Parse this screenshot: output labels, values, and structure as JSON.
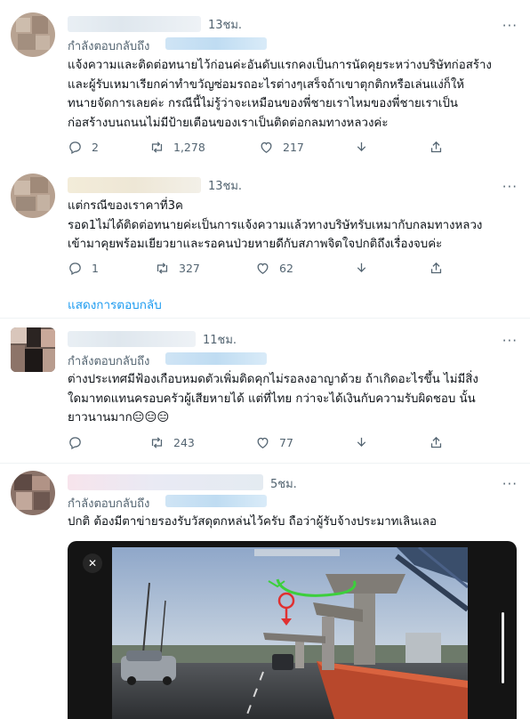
{
  "tweets": [
    {
      "time": "13ชม.",
      "reply_label": "กำลังตอบกลับถึง",
      "text": "แจ้งความและติดต่อทนายไว้ก่อนค่ะอันดับแรกคงเป็นการนัดคุยระหว่างบริษัทก่อสร้าง\nและผู้รับเหมาเรียกค่าทำขวัญซ่อมรถอะไรต่างๆเสร็จถ้าเขาตุกติกหรือเล่นแง่ก็ให้\nทนายจัดการเลยค่ะ กรณีนี้ไม่รู้ว่าจะเหมือนของพี่ชายเราไหมของพี่ชายเราเป็น\nก่อสร้างบนถนนไม่มีป้ายเตือนของเราเป็นติดต่อกลมทางหลวงค่ะ",
      "replies": "2",
      "retweets": "1,278",
      "likes": "217"
    },
    {
      "time": "13ชม.",
      "reply_label": "",
      "text": "แต่กรณีของเราคาที่3ค\nรอด1ไม่ได้ติดต่อทนายค่ะเป็นการแจ้งความแล้วทางบริษัทรับเหมากับกลมทางหลวง\nเข้ามาคุยพร้อมเยียวยาและรอคนป่วยหายดีกับสภาพจิตใจปกติถึงเรื่องจบค่ะ",
      "replies": "1",
      "retweets": "327",
      "likes": "62"
    },
    {
      "time": "11ชม.",
      "reply_label": "กำลังตอบกลับถึง",
      "text": "ต่างประเทศมีฟ้องเกือบหมดตัวเพิ่มติดคุกไม่รอลงอาญาด้วย ถ้าเกิดอะไรขึ้น ไม่มีสิ่ง\nใดมาทดแทนครอบครัวผู้เสียหายได้ แต่ที่ไทย กว่าจะได้เงินกับความรับผิดชอบ นั้น\nยาวนานมาก😑😑😑",
      "replies": "",
      "retweets": "243",
      "likes": "77"
    },
    {
      "time": "5ชม.",
      "reply_label": "กำลังตอบกลับถึง",
      "text": "ปกติ ต้องมีตาข่ายรองรับวัสดุตกหล่นไว้ครับ ถือว่าผู้รับจ้างประมาทเลินเลอ"
    }
  ],
  "show_replies_label": "แสดงการตอบกลับ",
  "more_label": "···",
  "media_close_label": "✕",
  "icons": {
    "reply": "reply-icon",
    "retweet": "retweet-icon",
    "like": "like-icon",
    "download": "download-icon",
    "share": "share-icon"
  },
  "colors": {
    "link": "#1d9bf0",
    "secondary": "#536471",
    "sky": "#aebfd6",
    "pillar": "#8e8b85",
    "annotation_green": "#3ccf3c",
    "annotation_red": "#e03030"
  }
}
